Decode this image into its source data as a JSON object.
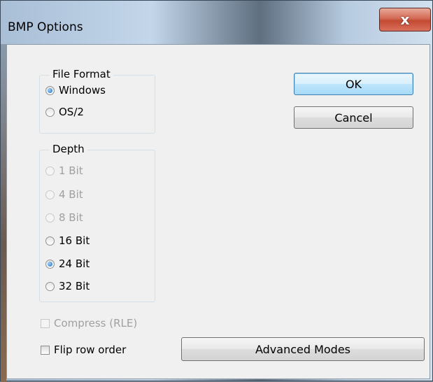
{
  "window": {
    "title": "BMP Options",
    "close_label": "x"
  },
  "file_format": {
    "legend": "File Format",
    "options": [
      {
        "label": "Windows",
        "checked": true,
        "enabled": true
      },
      {
        "label": "OS/2",
        "checked": false,
        "enabled": true
      }
    ]
  },
  "depth": {
    "legend": "Depth",
    "options": [
      {
        "label": "1 Bit",
        "checked": false,
        "enabled": false
      },
      {
        "label": "4 Bit",
        "checked": false,
        "enabled": false
      },
      {
        "label": "8 Bit",
        "checked": false,
        "enabled": false
      },
      {
        "label": "16 Bit",
        "checked": false,
        "enabled": true
      },
      {
        "label": "24 Bit",
        "checked": true,
        "enabled": true
      },
      {
        "label": "32 Bit",
        "checked": false,
        "enabled": true
      }
    ]
  },
  "compress": {
    "label": "Compress (RLE)",
    "checked": false,
    "enabled": false
  },
  "flip": {
    "label": "Flip row order",
    "checked": false,
    "enabled": true
  },
  "buttons": {
    "ok": "OK",
    "cancel": "Cancel",
    "advanced": "Advanced Modes"
  }
}
